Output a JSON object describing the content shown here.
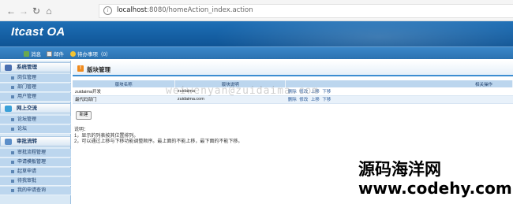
{
  "browser": {
    "url_host": "localhost",
    "url_path": ":8080/homeAction_index.action"
  },
  "app": {
    "title": "Itcast OA"
  },
  "toolbar": [
    {
      "label": "消息",
      "icon": "message-icon",
      "color": "#6aa84f"
    },
    {
      "label": "邮件",
      "icon": "mail-icon",
      "color": "#e8e8e8"
    },
    {
      "label": "待办事项（0）",
      "icon": "todo-icon",
      "color": "#f1c232"
    }
  ],
  "menu": {
    "groups": [
      {
        "label": "系统管理",
        "icon": "system-icon",
        "color": "#4a6fb0",
        "items": [
          "岗位管理",
          "部门管理",
          "用户管理"
        ]
      },
      {
        "label": "网上交流",
        "icon": "communication-icon",
        "color": "#3aa0d8",
        "items": [
          "论坛管理",
          "论坛"
        ]
      },
      {
        "label": "审批流转",
        "icon": "approval-icon",
        "color": "#5b8ec9",
        "items": [
          "审批流程管理",
          "申请模板管理",
          "起草申请",
          "待我审批",
          "我的申请查询"
        ]
      }
    ]
  },
  "main": {
    "title": "版块管理",
    "columns": [
      "版块名称",
      "版块说明",
      "相关操作"
    ],
    "rows": [
      {
        "name": "zuidaima开发",
        "desc": "zuidaima",
        "ops": [
          "删除",
          "修改",
          "上移",
          "下移"
        ]
      },
      {
        "name": "最代码部门",
        "desc": "zuidaima.com",
        "ops": [
          "删除",
          "修改",
          "上移",
          "下移"
        ]
      }
    ],
    "new_button": "新建",
    "notes": [
      "说明：",
      "1，显示的列表按其位置排列。",
      "2，可以通过上移与下移功能调整顺序。最上面的不能上移，最下面的不能下移。"
    ]
  },
  "watermark": "weiwenyan@zuidaima.com",
  "footer_watermark": {
    "line1": "源码海洋网",
    "line2": "www.codehy.com"
  }
}
